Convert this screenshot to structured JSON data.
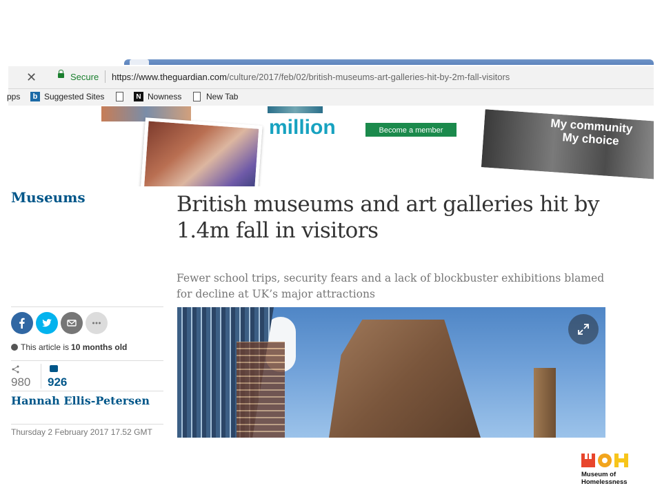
{
  "browser": {
    "secure_label": "Secure",
    "url_host": "https://www.theguardian.com",
    "url_path": "/culture/2017/feb/02/british-museums-art-galleries-hit-by-2m-fall-visitors",
    "bookmarks": [
      "pps",
      "Suggested Sites",
      "Nowness",
      "New Tab"
    ]
  },
  "banner": {
    "million_text": "million",
    "member_button": "Become a member",
    "community_line1": "My community",
    "community_line2": "My choice"
  },
  "article": {
    "section": "Museums",
    "headline": "British museums and art galleries hit by 1.4m fall in visitors",
    "standfirst": "Fewer school trips, security fears and a lack of blockbuster exhibitions blamed for decline at UK’s major attractions",
    "age_prefix": "This article is",
    "age_value": "10 months old",
    "share_count": "980",
    "comment_count": "926",
    "author": "Hannah Ellis-Petersen",
    "date": "Thursday 2 February 2017 17.52 GMT"
  },
  "logo": {
    "mark": "MOH",
    "line1": "Museum of",
    "line2": "Homelessness"
  },
  "colors": {
    "guardian_blue": "#005689",
    "facebook": "#3067a3",
    "twitter": "#03b3ee",
    "member_green": "#1b8a4c",
    "million_cyan": "#17a2c0"
  }
}
